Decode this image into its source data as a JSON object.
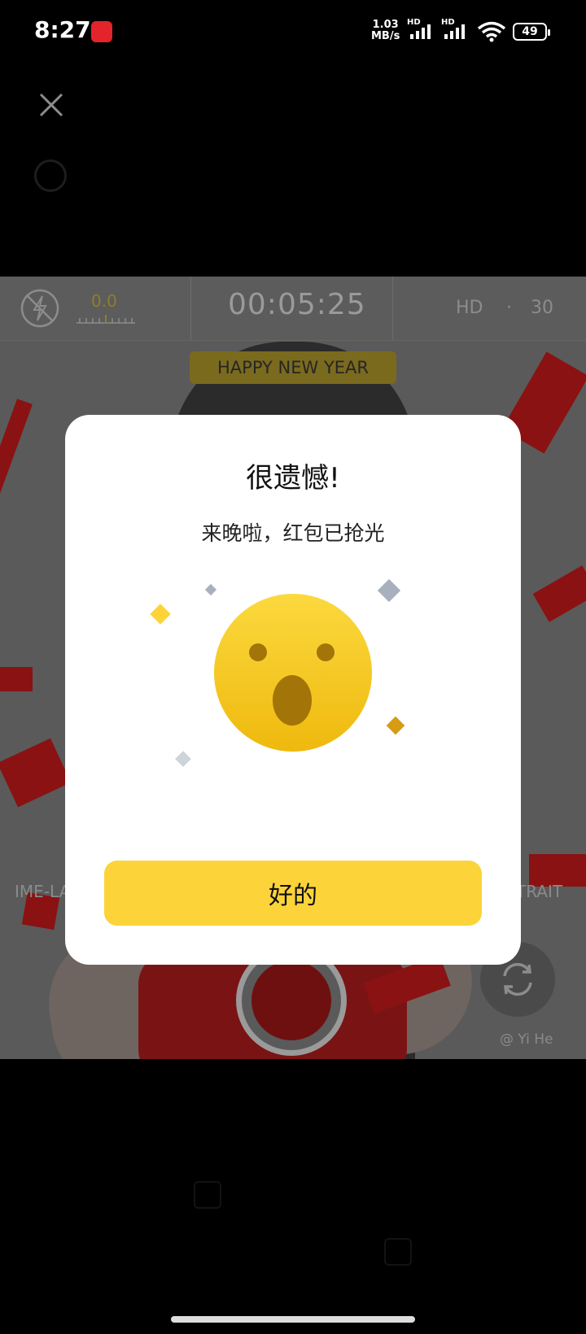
{
  "status_bar": {
    "time": "8:27",
    "net_speed_value": "1.03",
    "net_speed_unit": "MB/s",
    "sig1_label": "HD",
    "sig2_label": "HD",
    "battery": "49"
  },
  "recorder": {
    "exposure_value": "0.0",
    "timer": "00:05:25",
    "resolution": "HD",
    "separator": "·",
    "fps": "30",
    "badge": "HAPPY NEW YEAR",
    "mode_left": "IME-LA",
    "mode_right": "TRAIT",
    "watermark": "@ Yi He"
  },
  "dialog": {
    "title": "很遗憾!",
    "message": "来晚啦，红包已抢光",
    "confirm_label": "好的"
  },
  "colors": {
    "accent_yellow": "#fcd43a",
    "emoji_yellow": "#f2c21b",
    "backdrop": "#000000"
  },
  "icons": [
    "close-icon",
    "flash-off-icon",
    "camera-flip-icon",
    "surprised-face-icon"
  ]
}
